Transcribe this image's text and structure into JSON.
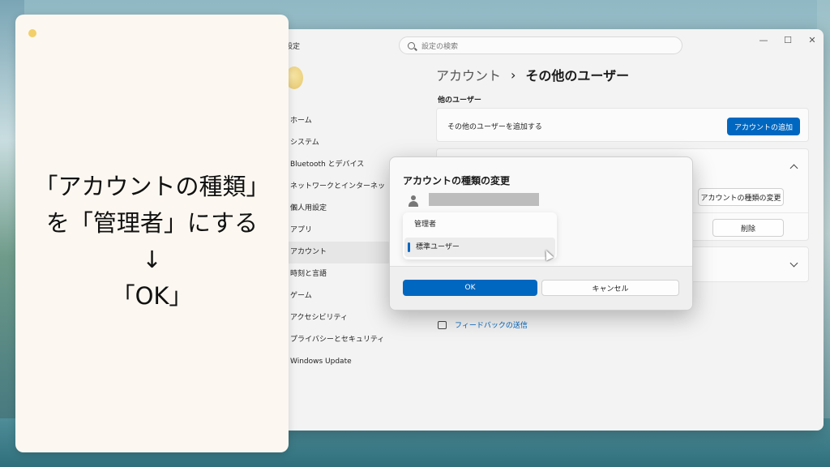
{
  "window": {
    "title": "設定",
    "controls": [
      "—",
      "☐",
      "✕"
    ]
  },
  "search": {
    "placeholder": "設定の検索"
  },
  "nav": {
    "items": [
      {
        "label": "ホーム",
        "active": false
      },
      {
        "label": "システム",
        "active": false
      },
      {
        "label": "Bluetooth とデバイス",
        "active": false
      },
      {
        "label": "ネットワークとインターネット",
        "active": false
      },
      {
        "label": "個人用設定",
        "active": false
      },
      {
        "label": "アプリ",
        "active": false
      },
      {
        "label": "アカウント",
        "active": true
      },
      {
        "label": "時刻と言語",
        "active": false
      },
      {
        "label": "ゲーム",
        "active": false
      },
      {
        "label": "アクセシビリティ",
        "active": false
      },
      {
        "label": "プライバシーとセキュリティ",
        "active": false
      },
      {
        "label": "Windows Update",
        "active": false
      }
    ]
  },
  "breadcrumb": {
    "parent": "アカウント",
    "separator": "›",
    "current": "その他のユーザー"
  },
  "section": {
    "label": "他のユーザー"
  },
  "add_card": {
    "label": "その他のユーザーを追加する",
    "button": "アカウントの追加"
  },
  "user_card": {
    "change_type_button": "アカウントの種類の変更",
    "delete_button": "削除"
  },
  "feedback": {
    "label": "フィードバックの送信"
  },
  "dialog": {
    "title": "アカウントの種類の変更",
    "options": [
      "管理者",
      "標準ユーザー"
    ],
    "selected": "標準ユーザー",
    "ok": "OK",
    "cancel": "キャンセル"
  },
  "note": {
    "lines": [
      "「アカウントの種類」",
      "を「管理者」にする",
      "↓",
      "「OK」"
    ]
  },
  "colors": {
    "accent": "#0067c0",
    "note_bg": "#fcf8f1"
  }
}
